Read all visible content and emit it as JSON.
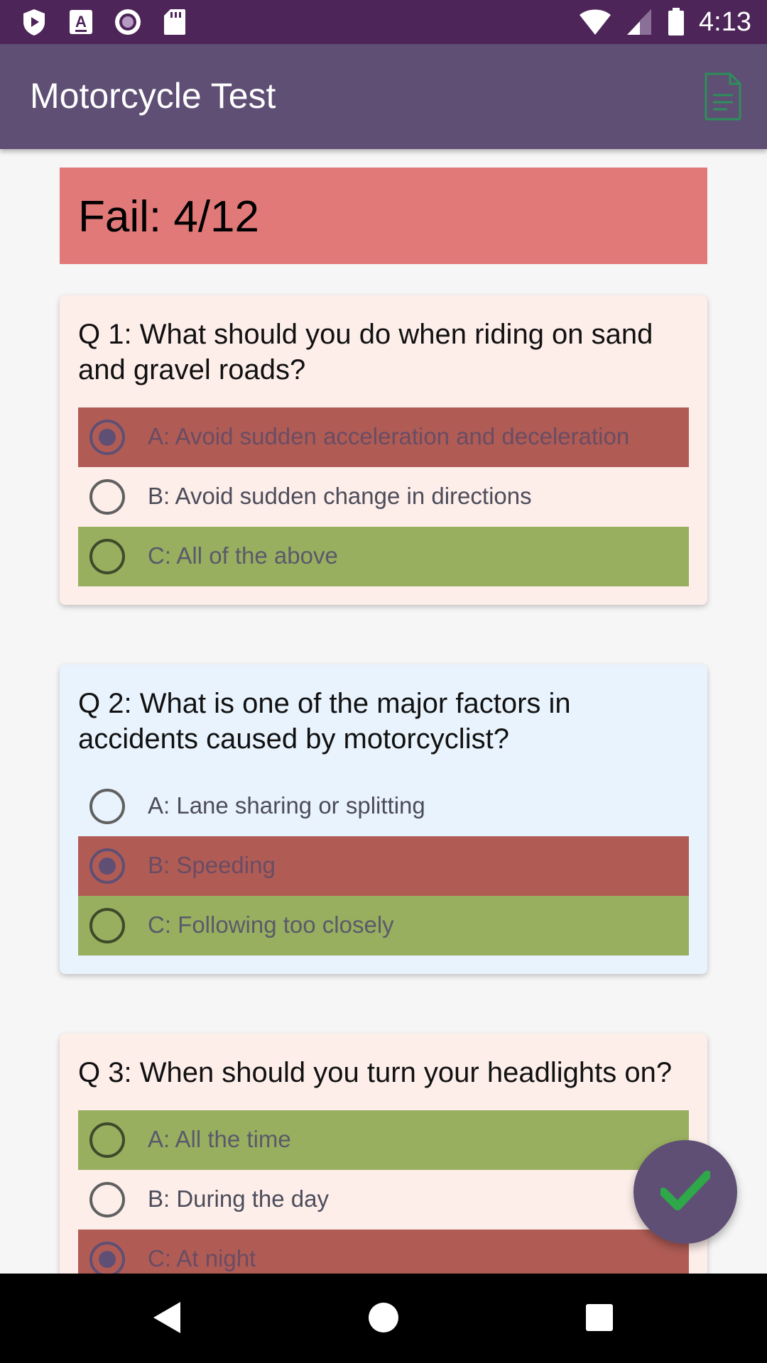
{
  "status_bar": {
    "time": "4:13",
    "left_icons": [
      "play-protect-icon",
      "a-keyboard-icon",
      "circle-record-icon",
      "sd-card-icon"
    ],
    "right_icons": [
      "wifi-icon",
      "signal-icon",
      "battery-icon"
    ]
  },
  "app_bar": {
    "title": "Motorcycle Test",
    "action_icon": "document-icon"
  },
  "result": {
    "text": "Fail: 4/12",
    "color": "#e27979"
  },
  "questions": [
    {
      "text": "Q 1: What should you do when riding on sand and gravel roads?",
      "options": [
        {
          "label": "A: Avoid sudden acceleration and deceleration",
          "state": "wrong",
          "selected": true
        },
        {
          "label": "B: Avoid sudden change in directions",
          "state": "none",
          "selected": false
        },
        {
          "label": "C: All of the above",
          "state": "correct",
          "selected": false
        }
      ]
    },
    {
      "text": "Q 2: What is one of the major factors in accidents caused by motorcyclist?",
      "options": [
        {
          "label": "A: Lane sharing or splitting",
          "state": "none",
          "selected": false
        },
        {
          "label": "B: Speeding",
          "state": "wrong",
          "selected": true
        },
        {
          "label": "C: Following too closely",
          "state": "correct",
          "selected": false
        }
      ]
    },
    {
      "text": "Q 3: When should you turn your headlights on?",
      "options": [
        {
          "label": "A: All the time",
          "state": "correct",
          "selected": false
        },
        {
          "label": "B: During the day",
          "state": "none",
          "selected": false
        },
        {
          "label": "C: At night",
          "state": "wrong",
          "selected": true
        }
      ]
    }
  ],
  "fab": {
    "icon": "checkmark-icon"
  },
  "colors": {
    "status_bar": "#4d2558",
    "app_bar": "#5f4f74",
    "wrong": "#b05c55",
    "correct": "#98af5f",
    "card_pink": "#fdeeea",
    "card_blue": "#e9f3fd",
    "check": "#2fa84a"
  },
  "nav_bar": {
    "icons": [
      "back-icon",
      "home-icon",
      "recents-icon"
    ]
  }
}
